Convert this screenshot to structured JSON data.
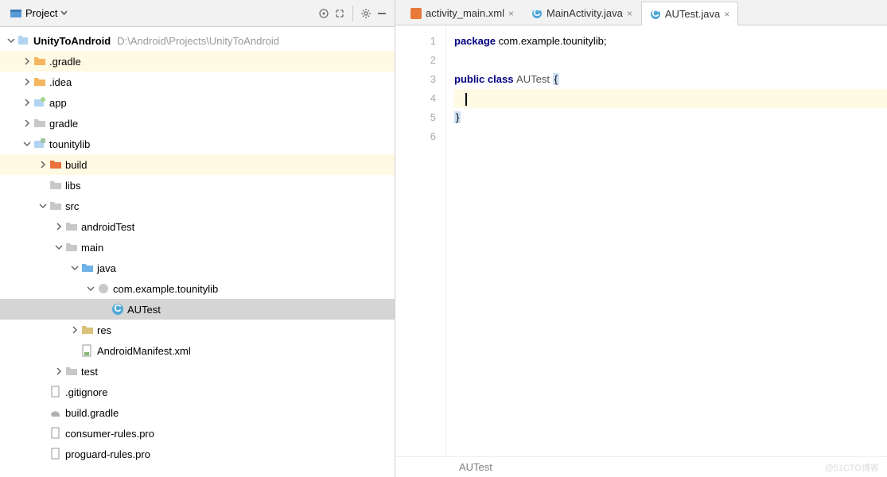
{
  "header": {
    "title": "Project"
  },
  "tree": {
    "root": {
      "name": "UnityToAndroid",
      "path": "D:\\Android\\Projects\\UnityToAndroid"
    },
    "gradle_dir": ".gradle",
    "idea_dir": ".idea",
    "app": "app",
    "gradle": "gradle",
    "tounitylib": "tounitylib",
    "build": "build",
    "libs": "libs",
    "src": "src",
    "androidTest": "androidTest",
    "main": "main",
    "java": "java",
    "pkg": "com.example.tounitylib",
    "autest": "AUTest",
    "res": "res",
    "manifest": "AndroidManifest.xml",
    "test": "test",
    "gitignore": ".gitignore",
    "buildgradle": "build.gradle",
    "consumer": "consumer-rules.pro",
    "proguard": "proguard-rules.pro"
  },
  "tabs": {
    "t1": "activity_main.xml",
    "t2": "MainActivity.java",
    "t3": "AUTest.java"
  },
  "gutter": {
    "l1": "1",
    "l2": "2",
    "l3": "3",
    "l4": "4",
    "l5": "5",
    "l6": "6"
  },
  "code": {
    "pkg_kw": "package",
    "pkg_rest": " com.example.tounitylib;",
    "public": "public ",
    "class": "class ",
    "clsname": "AUTest ",
    "lb": "{",
    "rb": "}"
  },
  "crumb": "AUTest",
  "watermark": "@51CTO博客"
}
